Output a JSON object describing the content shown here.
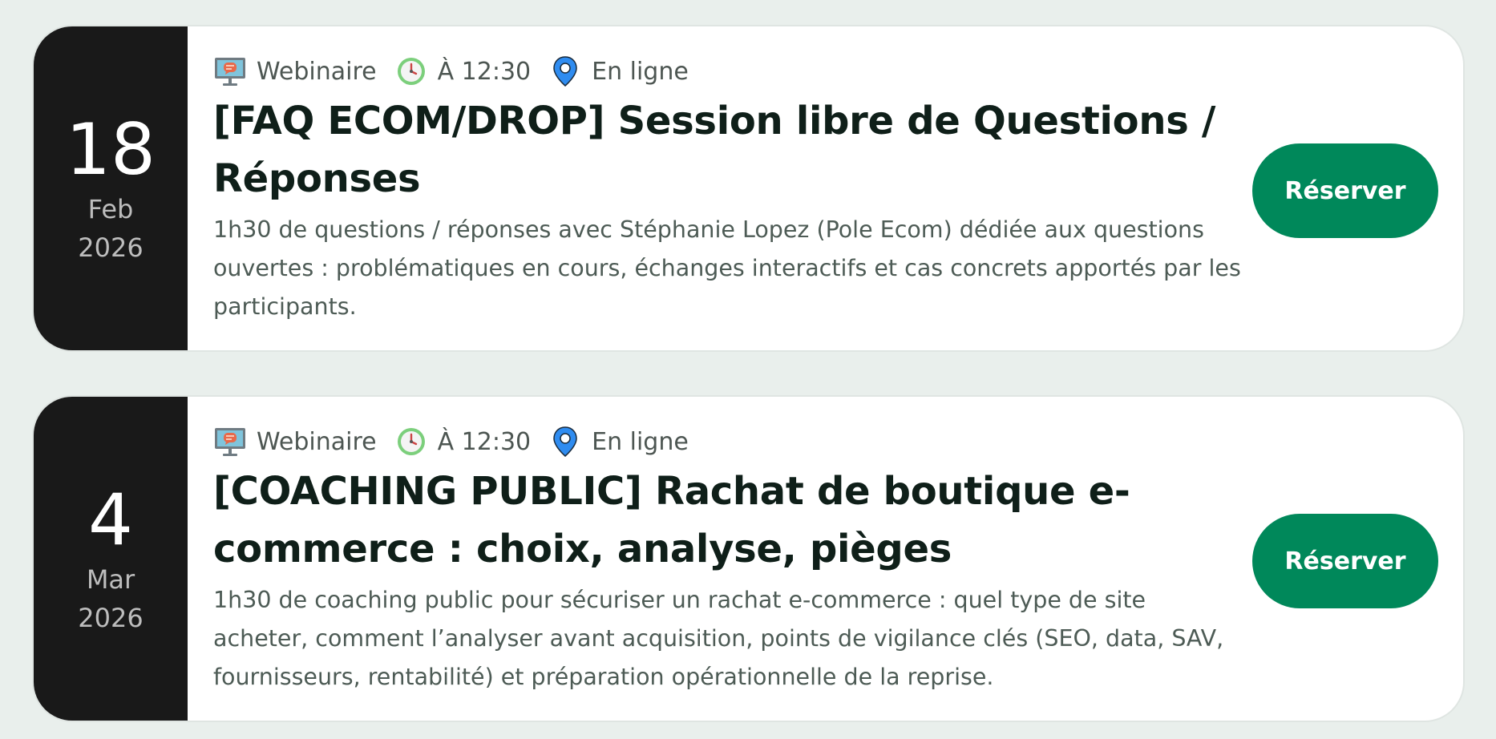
{
  "events": [
    {
      "day": "18",
      "month": "Feb",
      "year": "2026",
      "type": "Webinaire",
      "time": "À 12:30",
      "location": "En ligne",
      "title": "[FAQ ECOM/DROP] Session libre de Questions / Réponses",
      "description": "1h30 de questions / réponses avec Stéphanie Lopez (Pole Ecom) dédiée aux questions ouvertes : problématiques en cours, échanges interactifs et cas concrets apportés par les participants.",
      "cta": "Réserver"
    },
    {
      "day": "4",
      "month": "Mar",
      "year": "2026",
      "type": "Webinaire",
      "time": "À 12:30",
      "location": "En ligne",
      "title": "[COACHING PUBLIC] Rachat de boutique e-commerce : choix, analyse, pièges",
      "description": "1h30 de coaching public pour sécuriser un rachat e-commerce : quel type de site acheter, comment l’analyser avant acquisition, points de vigilance clés (SEO, data, SAV, fournisseurs, rentabilité) et préparation opérationnelle de la reprise.",
      "cta": "Réserver"
    }
  ],
  "icons": {
    "type": "computer-webinar-icon",
    "time": "clock-icon",
    "location": "map-pin-icon"
  },
  "colors": {
    "background": "#e9efec",
    "date_block": "#191919",
    "button": "#00885a",
    "title": "#0f1f19",
    "text": "#4d5b55"
  }
}
